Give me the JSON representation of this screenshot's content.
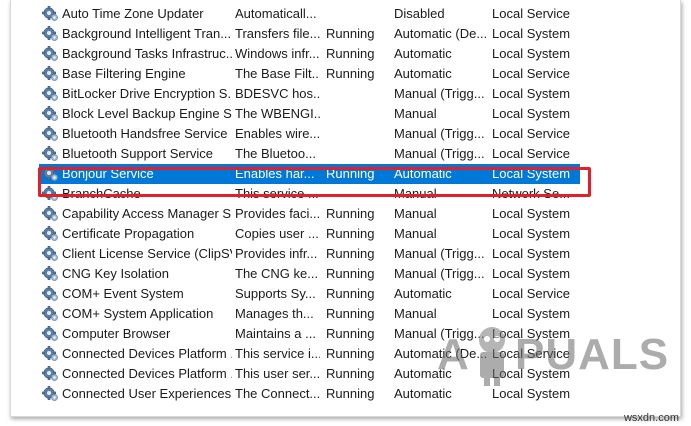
{
  "services": [
    {
      "name": "Auto Time Zone Updater",
      "description": "Automaticall...",
      "status": "",
      "startup": "Disabled",
      "logon": "Local Service"
    },
    {
      "name": "Background Intelligent Tran...",
      "description": "Transfers file...",
      "status": "Running",
      "startup": "Automatic (De...",
      "logon": "Local System"
    },
    {
      "name": "Background Tasks Infrastruc...",
      "description": "Windows infr...",
      "status": "Running",
      "startup": "Automatic",
      "logon": "Local System"
    },
    {
      "name": "Base Filtering Engine",
      "description": "The Base Filt...",
      "status": "Running",
      "startup": "Automatic",
      "logon": "Local Service"
    },
    {
      "name": "BitLocker Drive Encryption S...",
      "description": "BDESVC hos...",
      "status": "",
      "startup": "Manual (Trigg...",
      "logon": "Local System"
    },
    {
      "name": "Block Level Backup Engine S...",
      "description": "The WBENGI...",
      "status": "",
      "startup": "Manual",
      "logon": "Local System"
    },
    {
      "name": "Bluetooth Handsfree Service",
      "description": "Enables wire...",
      "status": "",
      "startup": "Manual (Trigg...",
      "logon": "Local Service"
    },
    {
      "name": "Bluetooth Support Service",
      "description": "The Bluetoo...",
      "status": "",
      "startup": "Manual (Trigg...",
      "logon": "Local Service"
    },
    {
      "name": "Bonjour Service",
      "description": "Enables har...",
      "status": "Running",
      "startup": "Automatic",
      "logon": "Local System"
    },
    {
      "name": "BranchCache",
      "description": "This service ...",
      "status": "",
      "startup": "Manual",
      "logon": "Network Se..."
    },
    {
      "name": "Capability Access Manager S...",
      "description": "Provides faci...",
      "status": "Running",
      "startup": "Manual",
      "logon": "Local System"
    },
    {
      "name": "Certificate Propagation",
      "description": "Copies user ...",
      "status": "Running",
      "startup": "Manual",
      "logon": "Local System"
    },
    {
      "name": "Client License Service (ClipSV",
      "description": "Provides infr...",
      "status": "Running",
      "startup": "Manual (Trigg...",
      "logon": "Local System"
    },
    {
      "name": "CNG Key Isolation",
      "description": "The CNG ke...",
      "status": "Running",
      "startup": "Manual (Trigg...",
      "logon": "Local System"
    },
    {
      "name": "COM+ Event System",
      "description": "Supports Sy...",
      "status": "Running",
      "startup": "Automatic",
      "logon": "Local Service"
    },
    {
      "name": "COM+ System Application",
      "description": "Manages th...",
      "status": "Running",
      "startup": "Manual",
      "logon": "Local System"
    },
    {
      "name": "Computer Browser",
      "description": "Maintains a ...",
      "status": "Running",
      "startup": "Manual (Trigg...",
      "logon": "Local System"
    },
    {
      "name": "Connected Devices Platform ...",
      "description": "This service i...",
      "status": "Running",
      "startup": "Automatic (De...",
      "logon": "Local Service"
    },
    {
      "name": "Connected Devices Platform ...",
      "description": "This user ser...",
      "status": "Running",
      "startup": "Automatic",
      "logon": "Local System"
    },
    {
      "name": "Connected User Experiences ...",
      "description": "The Connect...",
      "status": "Running",
      "startup": "Automatic",
      "logon": "Local System"
    }
  ],
  "selected_service": "Bonjour Service",
  "icon": "gear-service-icon",
  "highlight_color": "#e0202a",
  "selection_color": "#0078d7",
  "watermark": {
    "text_left": "A",
    "text_right": "PUALS"
  },
  "credit": "wsxdn.com"
}
